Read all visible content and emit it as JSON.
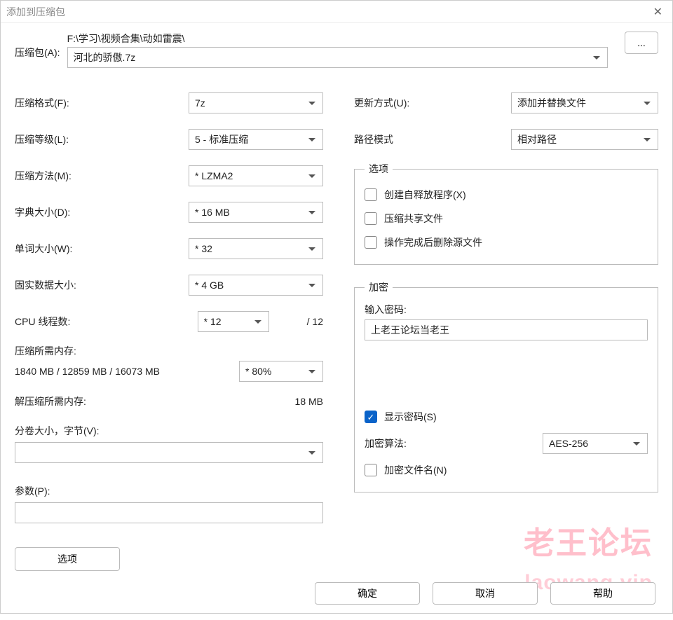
{
  "title": "添加到压缩包",
  "archive": {
    "label": "压缩包(A):",
    "path": "F:\\学习\\视频合集\\动如雷震\\",
    "name": "河北的骄傲.7z",
    "browse": "..."
  },
  "left": {
    "format_label": "压缩格式(F):",
    "format_value": "7z",
    "level_label": "压缩等级(L):",
    "level_value": "5 - 标准压缩",
    "method_label": "压缩方法(M):",
    "method_value": "* LZMA2",
    "dict_label": "字典大小(D):",
    "dict_value": "* 16 MB",
    "word_label": "单词大小(W):",
    "word_value": "* 32",
    "solid_label": "固实数据大小:",
    "solid_value": "* 4 GB",
    "threads_label": "CPU 线程数:",
    "threads_value": "* 12",
    "threads_total": "/ 12",
    "mem_comp_label": "压缩所需内存:",
    "mem_comp_value": "1840 MB / 12859 MB / 16073 MB",
    "mem_comp_pct": "* 80%",
    "mem_decomp_label": "解压缩所需内存:",
    "mem_decomp_value": "18 MB",
    "split_label": "分卷大小，字节(V):",
    "split_value": "",
    "params_label": "参数(P):",
    "params_value": "",
    "options_btn": "选项"
  },
  "right": {
    "update_label": "更新方式(U):",
    "update_value": "添加并替换文件",
    "path_label": "路径模式",
    "path_value": "相对路径",
    "opts_legend": "选项",
    "sfx_label": "创建自释放程序(X)",
    "shared_label": "压缩共享文件",
    "delete_label": "操作完成后删除源文件",
    "enc_legend": "加密",
    "pwd_label": "输入密码:",
    "pwd_value": "上老王论坛当老王",
    "show_pwd_label": "显示密码(S)",
    "algo_label": "加密算法:",
    "algo_value": "AES-256",
    "encnames_label": "加密文件名(N)"
  },
  "footer": {
    "ok": "确定",
    "cancel": "取消",
    "help": "帮助"
  },
  "watermark1": "老王论坛",
  "watermark2": "laowang.vip"
}
